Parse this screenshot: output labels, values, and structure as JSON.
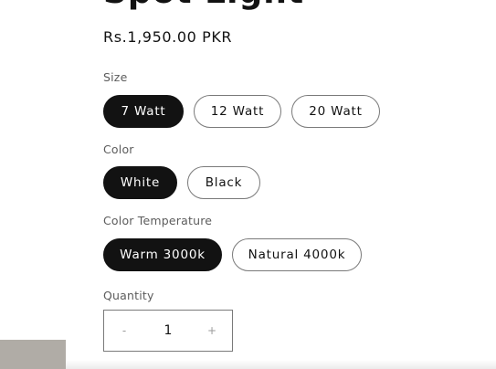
{
  "product": {
    "title": "Spot Light",
    "price": "Rs.1,950.00 PKR"
  },
  "options": {
    "size": {
      "label": "Size",
      "values": [
        "7 Watt",
        "12 Watt",
        "20 Watt"
      ],
      "selected": "7 Watt"
    },
    "color": {
      "label": "Color",
      "values": [
        "White",
        "Black"
      ],
      "selected": "White"
    },
    "temperature": {
      "label": "Color Temperature",
      "values": [
        "Warm 3000k",
        "Natural 4000k"
      ],
      "selected": "Warm 3000k"
    }
  },
  "quantity": {
    "label": "Quantity",
    "value": "1",
    "decrease": "-",
    "increase": "+"
  }
}
